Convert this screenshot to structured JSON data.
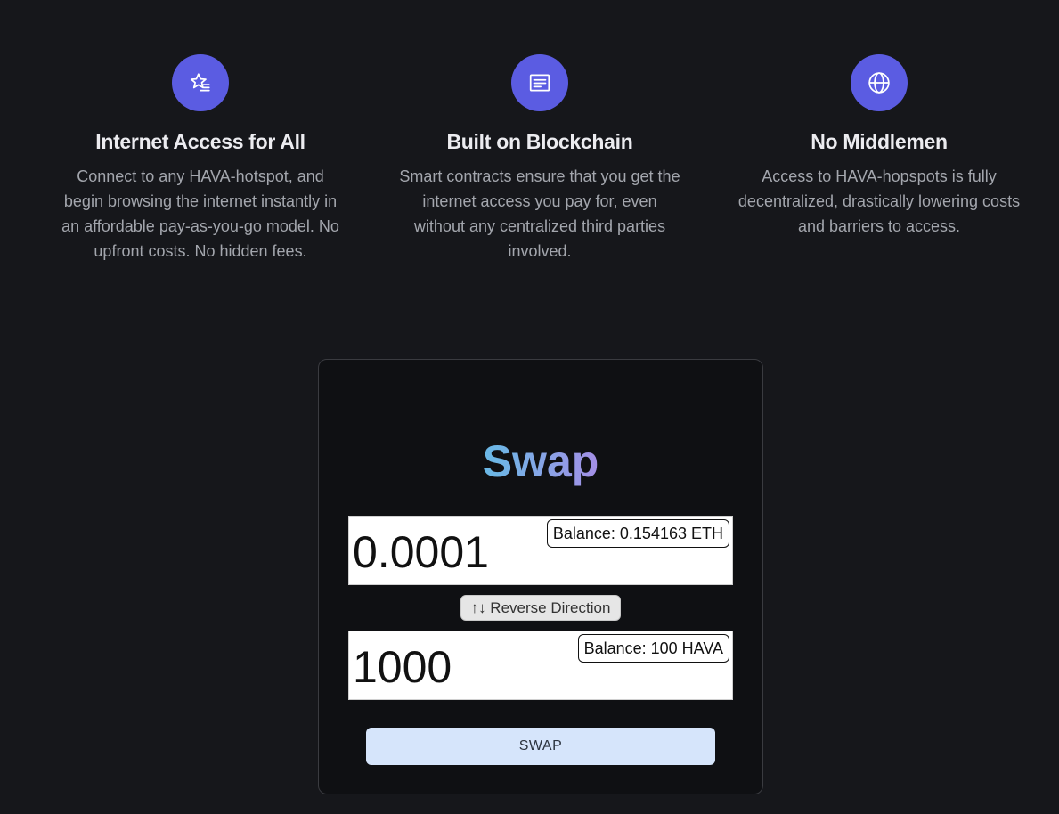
{
  "features": [
    {
      "icon": "star-list-icon",
      "title": "Internet Access for All",
      "text": "Connect to any HAVA-hotspot, and begin browsing the internet instantly in an affordable pay-as-you-go model. No upfront costs. No hidden fees."
    },
    {
      "icon": "document-icon",
      "title": "Built on Blockchain",
      "text": "Smart contracts ensure that you get the internet access you pay for, even without any centralized third parties involved."
    },
    {
      "icon": "globe-icon",
      "title": "No Middlemen",
      "text": "Access to HAVA-hopspots is fully decentralized, drastically lowering costs and barriers to access."
    }
  ],
  "swap": {
    "title": "Swap",
    "from": {
      "value": "0.0001",
      "balance": "Balance: 0.154163 ETH"
    },
    "reverse_label": "↑↓ Reverse Direction",
    "to": {
      "value": "1000",
      "balance": "Balance: 100 HAVA"
    },
    "swap_button": "SWAP"
  },
  "colors": {
    "background": "#16171b",
    "icon_bg": "#5b5ce2",
    "card_bg": "#0f1013",
    "swap_button_bg": "#d6e5fb",
    "title_gradient": [
      "#3ccfdc",
      "#d66fe8"
    ]
  }
}
